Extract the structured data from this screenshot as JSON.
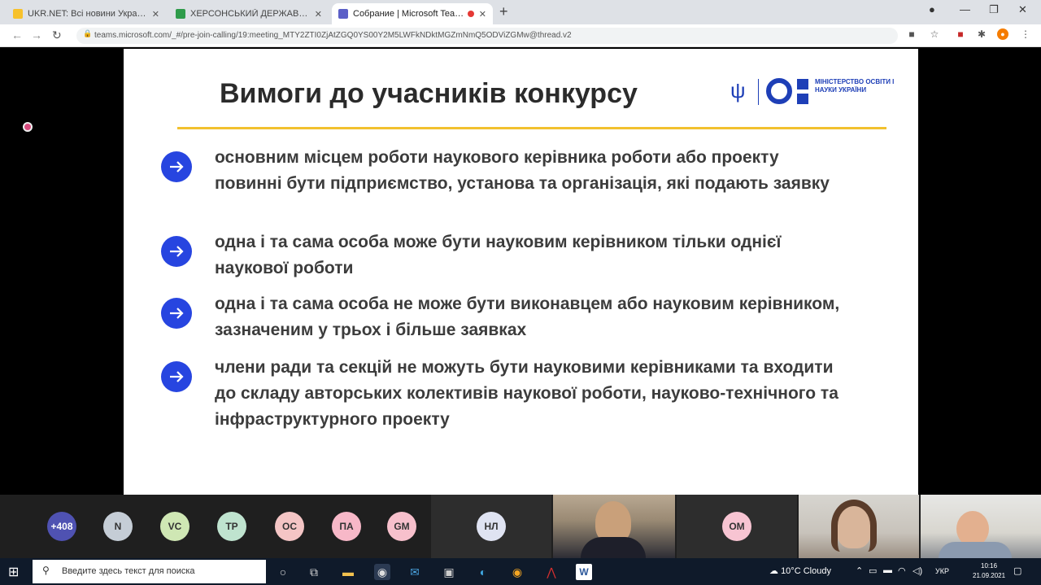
{
  "tabs": [
    {
      "label": "UKR.NET: Всі новини України"
    },
    {
      "label": "ХЕРСОНСЬКИЙ ДЕРЖАВНИЙ УНІВЕРСИТЕТ"
    },
    {
      "label": "Собрание | Microsoft Teams"
    }
  ],
  "address": {
    "url": "teams.microsoft.com/_#/pre-join-calling/19:meeting_MTY2ZTI0ZjAtZGQ0YS00Y2M5LWFkNDktMGZmNmQ5ODViZGMw@thread.v2"
  },
  "slide": {
    "title": "Вимоги до учасників конкурсу",
    "logo_text": "МІНІСТЕРСТВО ОСВІТИ І НАУКИ УКРАЇНИ",
    "bullets": [
      {
        "text": "основним місцем роботи наукового керівника роботи або проекту повинні бути підприємство, установа та організація, які подають заявку"
      },
      {
        "text": "одна і та сама особа може бути науковим керівником тільки однієї наукової роботи"
      },
      {
        "text": "одна і та сама особа не може бути виконавцем або науковим керівником, зазначеним у трьох і більше заявках"
      },
      {
        "text": "члени ради та секцій не можуть бути науковими керівниками та входити до складу авторських колективів наукової роботи, науково-технічного та інфраструктурного проекту"
      }
    ]
  },
  "participants": {
    "overflow": "+408",
    "avatars": [
      {
        "initials": "N",
        "color": "#c5cdd6"
      },
      {
        "initials": "VC",
        "color": "#cfe7b4"
      },
      {
        "initials": "TP",
        "color": "#bfe3cf"
      },
      {
        "initials": "OC",
        "color": "#f4c5c5"
      },
      {
        "initials": "ПА",
        "color": "#f7b8c8"
      },
      {
        "initials": "GM",
        "color": "#f7c0cc"
      }
    ],
    "tile_initials": [
      {
        "initials": "НЛ",
        "color": "#dfe3f2"
      },
      {
        "initials": "OM",
        "color": "#f7c4d2"
      }
    ]
  },
  "taskbar": {
    "search_placeholder": "Введите здесь текст для поиска",
    "weather": "10°C Cloudy",
    "lang": "УКР",
    "time": "10:16",
    "date": "21.09.2021"
  }
}
